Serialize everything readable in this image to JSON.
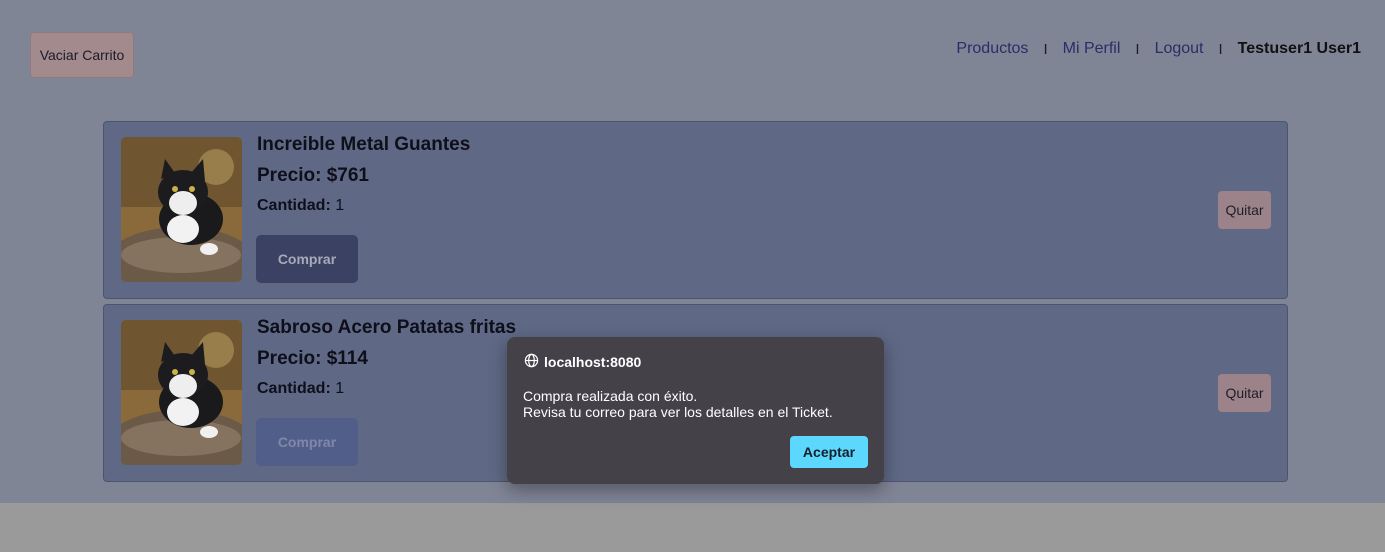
{
  "header": {
    "clear_cart_label": "Vaciar Carrito",
    "nav": {
      "products": "Productos",
      "profile": "Mi Perfil",
      "logout": "Logout",
      "separator": "I",
      "user_name": "Testuser1 User1"
    }
  },
  "cart": {
    "items": [
      {
        "name": "Increible Metal Guantes",
        "price": "Precio: $761",
        "quantity_label": "Cantidad:",
        "quantity": "1",
        "buy_label": "Comprar",
        "remove_label": "Quitar"
      },
      {
        "name": "Sabroso Acero Patatas fritas",
        "price": "Precio: $114",
        "quantity_label": "Cantidad:",
        "quantity": "1",
        "buy_label": "Comprar",
        "remove_label": "Quitar"
      }
    ]
  },
  "dialog": {
    "origin": "localhost:8080",
    "message_line1": "Compra realizada con éxito.",
    "message_line2": "Revisa tu correo para ver los detalles en el Ticket.",
    "ok_label": "Aceptar"
  },
  "colors": {
    "overlay": "#808596",
    "card_bg": "#5f6985",
    "dialog_bg": "#444149",
    "accept_button": "#5cd8ff"
  }
}
